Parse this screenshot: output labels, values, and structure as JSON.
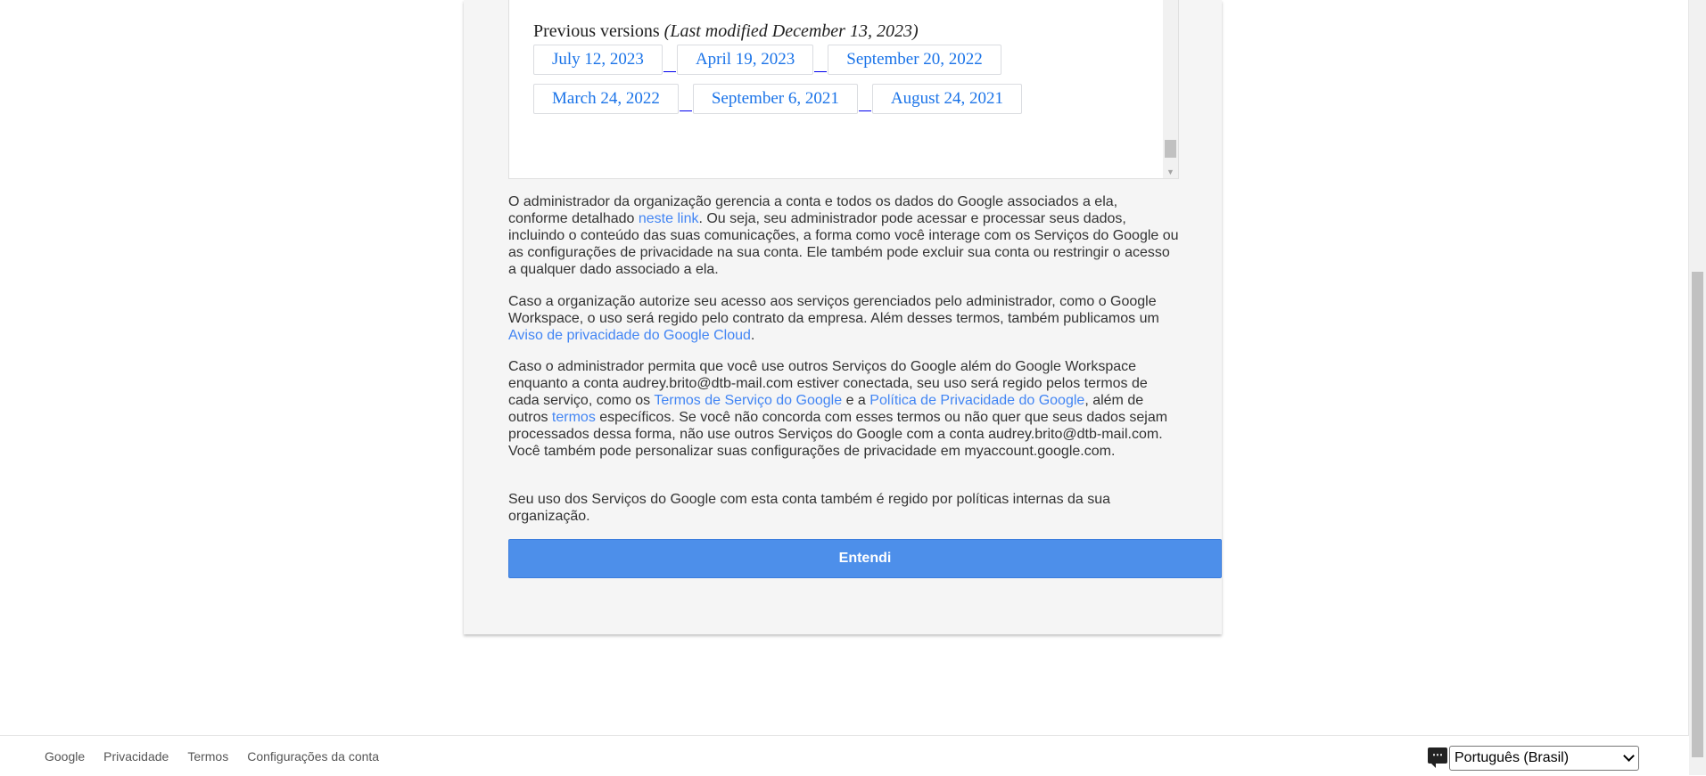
{
  "tos_frame": {
    "previous_versions_label": "Previous versions",
    "last_modified": "(Last modified December 13, 2023)",
    "versions_row1": [
      "July 12, 2023",
      "April 19, 2023",
      "September 20, 2022"
    ],
    "versions_row2": [
      "March 24, 2022",
      "September 6, 2021",
      "August 24, 2021"
    ]
  },
  "paragraphs": {
    "p1": {
      "t1": "O administrador da organização gerencia a conta e todos os dados do Google associados a ela, conforme detalhado ",
      "link1": "neste link",
      "t2": ". Ou seja, seu administrador pode acessar e processar seus dados, incluindo o conteúdo das suas comunicações, a forma como você interage com os Serviços do Google ou as configurações de privacidade na sua conta. Ele também pode excluir sua conta ou restringir o acesso a qualquer dado associado a ela."
    },
    "p2": {
      "t1": "Caso a organização autorize seu acesso aos serviços gerenciados pelo administrador, como o Google Workspace, o uso será regido pelo contrato da empresa. Além desses termos, também publicamos um ",
      "link1": "Aviso de privacidade do Google Cloud",
      "t2": "."
    },
    "p3": {
      "t1": "Caso o administrador permita que você use outros Serviços do Google além do Google Workspace enquanto a conta audrey.brito@dtb-mail.com estiver conectada, seu uso será regido pelos termos de cada serviço, como os ",
      "link1": "Termos de Serviço do Google",
      "t2": " e a ",
      "link2": "Política de Privacidade do Google",
      "t3": ", além de outros ",
      "link3": "termos",
      "t4": " específicos. Se você não concorda com esses termos ou não quer que seus dados sejam processados dessa forma, não use outros Serviços do Google com a conta audrey.brito@dtb-mail.com. Você também pode personalizar suas configurações de privacidade em myaccount.google.com."
    },
    "p4": {
      "t1": "Seu uso dos Serviços do Google com esta conta também é regido por políticas internas da sua organização."
    }
  },
  "accept_button_label": "Entendi",
  "footer": {
    "links": [
      "Google",
      "Privacidade",
      "Termos",
      "Configurações da conta"
    ],
    "language": "Português (Brasil)"
  },
  "colors": {
    "link": "#4285f4",
    "primary_button": "#4d8fea",
    "card_background": "#f5f5f5"
  }
}
